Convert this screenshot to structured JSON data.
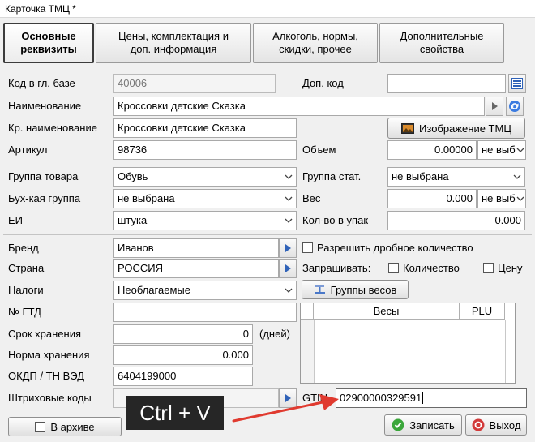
{
  "window": {
    "title": "Карточка ТМЦ *"
  },
  "tabs": [
    {
      "label": "Основные\nреквизиты"
    },
    {
      "label": "Цены, комплектация и\nдоп.  информация"
    },
    {
      "label": "Алкоголь, нормы,\nскидки, прочее"
    },
    {
      "label": "Дополнительные\nсвойства"
    }
  ],
  "form": {
    "base_code": {
      "label": "Код в гл. базе",
      "value": "40006"
    },
    "extra_code": {
      "label": "Доп. код",
      "value": ""
    },
    "name": {
      "label": "Наименование",
      "value": "Кроссовки детские Сказка"
    },
    "short_name": {
      "label": "Кр. наименование",
      "value": "Кроссовки детские Сказка"
    },
    "image_button": "Изображение ТМЦ",
    "article": {
      "label": "Артикул",
      "value": "98736"
    },
    "volume": {
      "label": "Объем",
      "value": "0.00000",
      "unit": "не выб"
    },
    "product_group": {
      "label": "Группа товара",
      "value": "Обувь"
    },
    "stat_group": {
      "label": "Группа стат.",
      "value": "не выбрана"
    },
    "acc_group": {
      "label": "Бух-кая группа",
      "value": "не выбрана"
    },
    "weight": {
      "label": "Вес",
      "value": "0.000",
      "unit": "не выб"
    },
    "unit": {
      "label": "ЕИ",
      "value": "штука"
    },
    "pack_qty": {
      "label": "Кол-во в упак",
      "value": "0.000"
    },
    "brand": {
      "label": "Бренд",
      "value": "Иванов"
    },
    "country": {
      "label": "Страна",
      "value": "РОССИЯ"
    },
    "taxes": {
      "label": "Налоги",
      "value": "Необлагаемые"
    },
    "gtd": {
      "label": "№ ГТД",
      "value": ""
    },
    "shelf_life": {
      "label": "Срок хранения",
      "value": "0",
      "unit": "(дней)"
    },
    "storage_norm": {
      "label": "Норма хранения",
      "value": "0.000"
    },
    "okdp": {
      "label": "ОКДП / ТН ВЭД",
      "value": "6404199000"
    },
    "barcodes": {
      "label": "Штриховые коды",
      "value": ""
    },
    "gtin": {
      "label": "GTIN",
      "value": "02900000329591"
    },
    "allow_fraction": {
      "label": "Разрешить дробное количество",
      "checked": false
    },
    "ask": {
      "label": "Запрашивать:",
      "qty_label": "Количество",
      "price_label": "Цену"
    },
    "scale_groups_button": "Группы весов",
    "scales_table": {
      "columns": [
        "Весы",
        "PLU"
      ]
    },
    "archive": {
      "label": "В архиве",
      "checked": false
    }
  },
  "actions": {
    "save": "Записать",
    "exit": "Выход"
  },
  "overlay": {
    "hint": "Ctrl + V"
  },
  "colors": {
    "arrow": "#e03a2f",
    "save_icon": "#3aa63a",
    "exit_icon": "#d23a3a"
  }
}
